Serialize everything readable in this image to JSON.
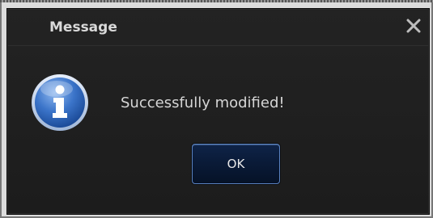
{
  "dialog": {
    "title": "Message",
    "message": "Successfully modified!",
    "ok_label": "OK",
    "close_icon": "close-icon",
    "info_icon": "info-icon"
  },
  "colors": {
    "dialog_bg": "#202020",
    "title_text": "#d9d9d9",
    "message_text": "#d6d6d6",
    "button_bg": "#0a1b38",
    "button_border": "#5a83c2",
    "icon_blue": "#3b74c9"
  }
}
